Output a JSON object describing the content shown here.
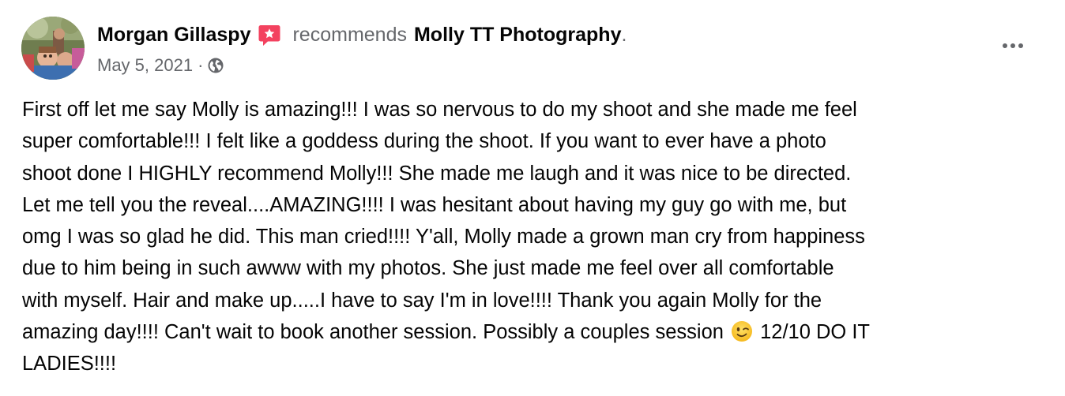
{
  "post": {
    "author": "Morgan Gillaspy",
    "recommendation_text": "recommends",
    "page_name": "Molly TT Photography",
    "period": ".",
    "date": "May 5, 2021",
    "meta_separator": "·",
    "privacy_icon": "globe-icon",
    "more_icon": "more-options-icon",
    "badge_icon": "recommendation-star-icon",
    "body_lines": [
      "First off let me say Molly is amazing!!! I was so nervous to do my shoot and she made me feel",
      "super comfortable!!! I felt like a goddess during the shoot. If you want to ever have a photo",
      "shoot done I HIGHLY recommend Molly!!! She made me laugh and it was nice to be directed.",
      "Let me tell you the reveal....AMAZING!!!! I was hesitant about having my guy go with me, but",
      "omg I was so glad he did. This man cried!!!! Y'all, Molly made a grown man cry from happiness",
      "due to him being in such awww with my photos. She just made me feel over all comfortable",
      "with myself. Hair and make up.....I have to say I'm in love!!!! Thank you again Molly for the"
    ],
    "body_line_8_before_emoji": "amazing day!!!! Can't wait to book another session. Possibly a couples session ",
    "body_emoji": "winking-face-emoji",
    "body_line_8_after_emoji": " 12/10 DO IT",
    "body_line_9": "LADIES!!!!"
  },
  "colors": {
    "primary_text": "#050505",
    "secondary_text": "#65676b",
    "badge": "#f3425f"
  }
}
